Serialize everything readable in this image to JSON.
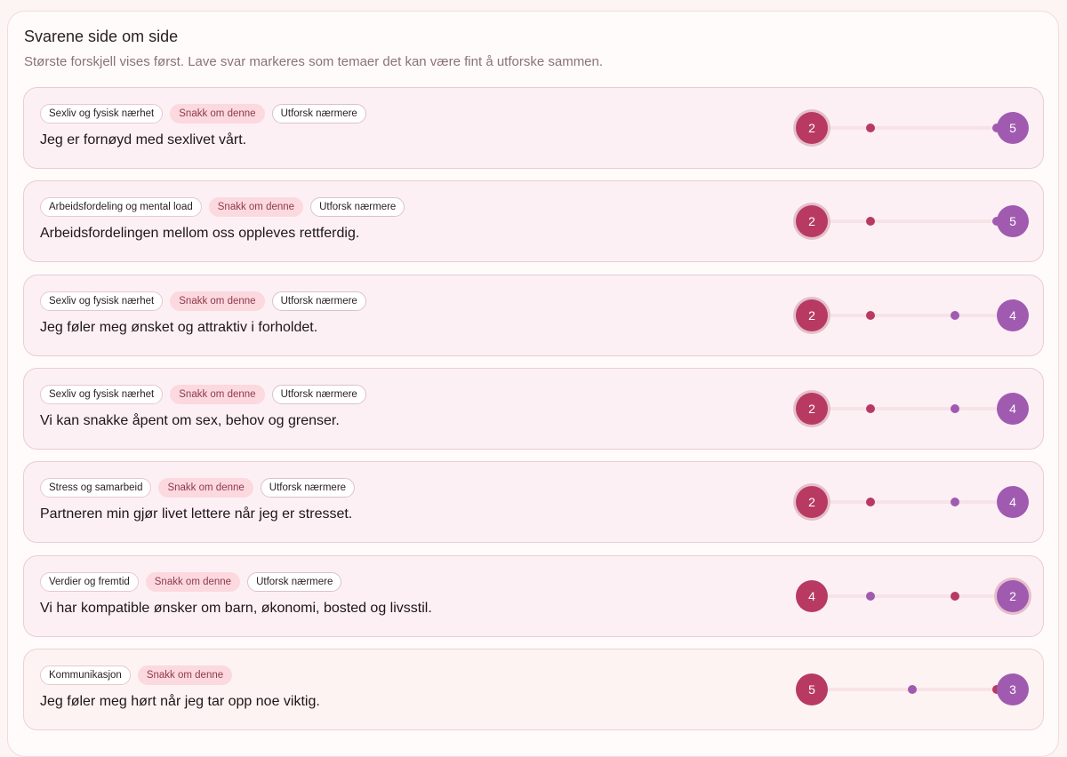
{
  "header": {
    "title": "Svarene side om side",
    "subtitle": "Største forskjell vises først. Lave svar markeres som temaer det kan være fint å utforske sammen."
  },
  "colors": {
    "partner_a": "#b83a62",
    "partner_b": "#a05bb0",
    "talk_tag_bg": "#fbd9df"
  },
  "scale": {
    "min": 1,
    "max": 5
  },
  "items": [
    {
      "category": "Sexliv og fysisk nærhet",
      "talk": "Snakk om denne",
      "explore": "Utforsk nærmere",
      "statement": "Jeg er fornøyd med sexlivet vårt.",
      "a": "2",
      "b": "5",
      "lower": "a"
    },
    {
      "category": "Arbeidsfordeling og mental load",
      "talk": "Snakk om denne",
      "explore": "Utforsk nærmere",
      "statement": "Arbeidsfordelingen mellom oss oppleves rettferdig.",
      "a": "2",
      "b": "5",
      "lower": "a"
    },
    {
      "category": "Sexliv og fysisk nærhet",
      "talk": "Snakk om denne",
      "explore": "Utforsk nærmere",
      "statement": "Jeg føler meg ønsket og attraktiv i forholdet.",
      "a": "2",
      "b": "4",
      "lower": "a"
    },
    {
      "category": "Sexliv og fysisk nærhet",
      "talk": "Snakk om denne",
      "explore": "Utforsk nærmere",
      "statement": "Vi kan snakke åpent om sex, behov og grenser.",
      "a": "2",
      "b": "4",
      "lower": "a"
    },
    {
      "category": "Stress og samarbeid",
      "talk": "Snakk om denne",
      "explore": "Utforsk nærmere",
      "statement": "Partneren min gjør livet lettere når jeg er stresset.",
      "a": "2",
      "b": "4",
      "lower": "a"
    },
    {
      "category": "Verdier og fremtid",
      "talk": "Snakk om denne",
      "explore": "Utforsk nærmere",
      "statement": "Vi har kompatible ønsker om barn, økonomi, bosted og livsstil.",
      "a": "4",
      "b": "2",
      "lower": "b"
    },
    {
      "category": "Kommunikasjon",
      "talk": "Snakk om denne",
      "explore": "",
      "statement": "Jeg føler meg hørt når jeg tar opp noe viktig.",
      "a": "5",
      "b": "3",
      "lower": ""
    }
  ]
}
